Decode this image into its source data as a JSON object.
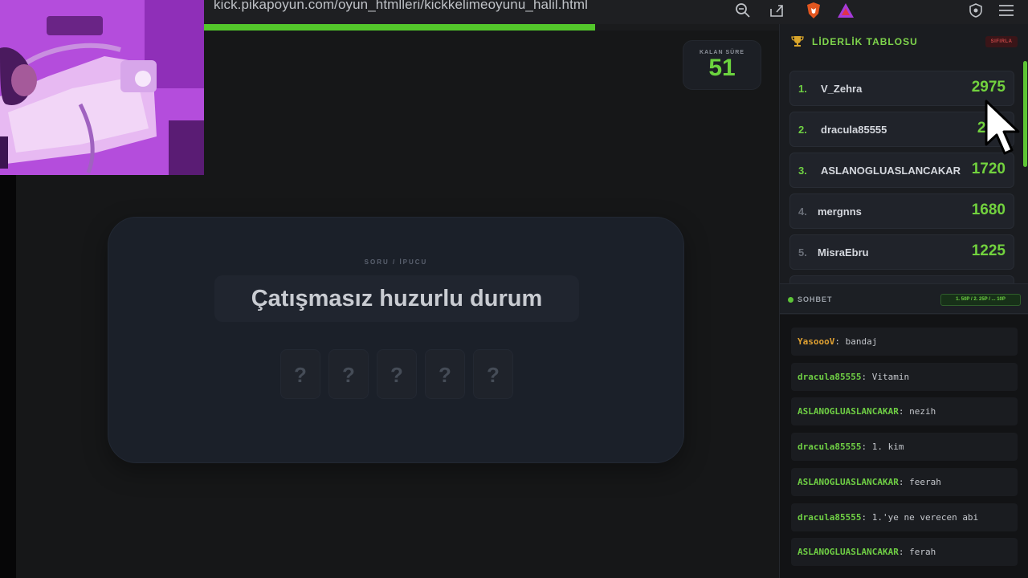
{
  "browser": {
    "url": "kick.pikapoyun.com/oyun_htmlleri/kickkelimeoyunu_halil.html",
    "progress": 0.68
  },
  "timer": {
    "label": "KALAN SÜRE",
    "value": "51"
  },
  "card": {
    "label": "SORU / İPUCU",
    "question": "Çatışmasız huzurlu durum",
    "slots": [
      "?",
      "?",
      "?",
      "?",
      "?"
    ]
  },
  "leaderboard": {
    "title": "LİDERLİK TABLOSU",
    "reset_label": "SIFIRLA",
    "rows": [
      {
        "rank": "1.",
        "name": "V_Zehra",
        "score": "2975"
      },
      {
        "rank": "2.",
        "name": "dracula85555",
        "score": "28"
      },
      {
        "rank": "3.",
        "name": "ASLANOGLUASLANCAKAR",
        "score": "1720"
      },
      {
        "rank": "4.",
        "name": "mergnns",
        "score": "1680"
      },
      {
        "rank": "5.",
        "name": "MisraEbru",
        "score": "1225"
      }
    ]
  },
  "chat": {
    "title": "SOHBET",
    "badge": "1. 50P / 2. 25P / ... 10P",
    "messages": [
      {
        "user": "YasoooV",
        "text": ": bandaj",
        "color": "#e0a132"
      },
      {
        "user": "dracula85555",
        "text": ": Vitamin",
        "color": "#6fcf44"
      },
      {
        "user": "ASLANOGLUASLANCAKAR",
        "text": ": nezih",
        "color": "#6fcf44"
      },
      {
        "user": "dracula85555",
        "text": ": 1. kim",
        "color": "#6fcf44"
      },
      {
        "user": "ASLANOGLUASLANCAKAR",
        "text": ": feerah",
        "color": "#6fcf44"
      },
      {
        "user": "dracula85555",
        "text": ": 1.'ye ne verecen abi",
        "color": "#6fcf44"
      },
      {
        "user": "ASLANOGLUASLANCAKAR",
        "text": ": ferah",
        "color": "#6fcf44"
      }
    ]
  },
  "colors": {
    "accent": "#53c72b",
    "background": "#151617",
    "danger": "#c94848"
  }
}
